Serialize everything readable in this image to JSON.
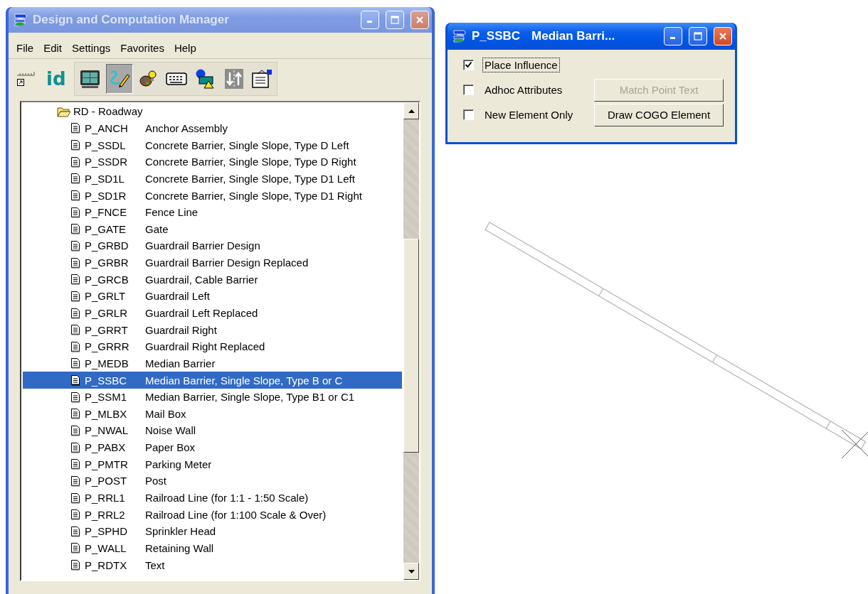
{
  "main_window": {
    "title": "Design and Computation Manager",
    "active": false,
    "menu": [
      "File",
      "Edit",
      "Settings",
      "Favorites",
      "Help"
    ],
    "toolbar": {
      "standalone": [
        {
          "kind": "ruler",
          "selected": false
        },
        {
          "kind": "text",
          "label": "id",
          "selected": false
        }
      ],
      "group": [
        {
          "kind": "monitor",
          "selected": false
        },
        {
          "kind": "pencil",
          "selected": true
        },
        {
          "kind": "palette",
          "selected": false
        },
        {
          "kind": "keypad",
          "selected": false
        },
        {
          "kind": "shapes",
          "selected": false
        },
        {
          "kind": "arrows",
          "selected": false
        },
        {
          "kind": "clipboard",
          "selected": false
        }
      ]
    },
    "tree": {
      "label": "RD - Roadway",
      "expanded": true,
      "children": [
        {
          "code": "P_ANCH",
          "description": "Anchor Assembly",
          "selected": false
        },
        {
          "code": "P_SSDL",
          "description": "Concrete Barrier, Single Slope, Type D Left",
          "selected": false
        },
        {
          "code": "P_SSDR",
          "description": "Concrete Barrier, Single Slope, Type D Right",
          "selected": false
        },
        {
          "code": "P_SD1L",
          "description": "Concrete Barrier, Single Slope, Type D1 Left",
          "selected": false
        },
        {
          "code": "P_SD1R",
          "description": "Concrete Barrier, Single Slope, Type D1 Right",
          "selected": false
        },
        {
          "code": "P_FNCE",
          "description": "Fence Line",
          "selected": false
        },
        {
          "code": "P_GATE",
          "description": "Gate",
          "selected": false
        },
        {
          "code": "P_GRBD",
          "description": "Guardrail Barrier Design",
          "selected": false
        },
        {
          "code": "P_GRBR",
          "description": "Guardrail Barrier Design Replaced",
          "selected": false
        },
        {
          "code": "P_GRCB",
          "description": "Guardrail, Cable Barrier",
          "selected": false
        },
        {
          "code": "P_GRLT",
          "description": "Guardrail Left",
          "selected": false
        },
        {
          "code": "P_GRLR",
          "description": "Guardrail Left Replaced",
          "selected": false
        },
        {
          "code": "P_GRRT",
          "description": "Guardrail Right",
          "selected": false
        },
        {
          "code": "P_GRRR",
          "description": "Guardrail Right Replaced",
          "selected": false
        },
        {
          "code": "P_MEDB",
          "description": "Median Barrier",
          "selected": false
        },
        {
          "code": "P_SSBC",
          "description": "Median Barrier, Single Slope, Type B or C",
          "selected": true
        },
        {
          "code": "P_SSM1",
          "description": "Median Barrier, Single Slope, Type B1 or C1",
          "selected": false
        },
        {
          "code": "P_MLBX",
          "description": "Mail Box",
          "selected": false
        },
        {
          "code": "P_NWAL",
          "description": "Noise Wall",
          "selected": false
        },
        {
          "code": "P_PABX",
          "description": "Paper Box",
          "selected": false
        },
        {
          "code": "P_PMTR",
          "description": "Parking Meter",
          "selected": false
        },
        {
          "code": "P_POST",
          "description": "Post",
          "selected": false
        },
        {
          "code": "P_RRL1",
          "description": "Railroad Line (for 1:1 - 1:50 Scale)",
          "selected": false
        },
        {
          "code": "P_RRL2",
          "description": "Railroad Line (for 1:100 Scale & Over)",
          "selected": false
        },
        {
          "code": "P_SPHD",
          "description": "Sprinkler Head",
          "selected": false
        },
        {
          "code": "P_WALL",
          "description": "Retaining Wall",
          "selected": false
        },
        {
          "code": "P_RDTX",
          "description": "Text",
          "selected": false
        }
      ]
    }
  },
  "dialog": {
    "title_code": "P_SSBC",
    "title_name": "Median Barri...",
    "active": true,
    "options": [
      {
        "label": "Place Influence",
        "checked": true,
        "focused": true
      },
      {
        "label": "Adhoc Attributes",
        "checked": false,
        "focused": false
      },
      {
        "label": "New Element Only",
        "checked": false,
        "focused": false
      }
    ],
    "buttons": [
      {
        "label": "Match Point Text",
        "disabled": true
      },
      {
        "label": "Draw COGO Element",
        "disabled": false
      }
    ]
  }
}
